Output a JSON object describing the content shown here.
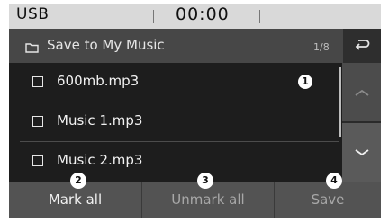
{
  "status_bar": {
    "source": "USB",
    "time": "00:00"
  },
  "header": {
    "folder_icon": "folder-icon",
    "title": "Save to My Music",
    "page_count": "1/8",
    "back_icon": "back-return-icon"
  },
  "files": [
    {
      "name": "600mb.mp3",
      "checked": false
    },
    {
      "name": "Music 1.mp3",
      "checked": false
    },
    {
      "name": "Music 2.mp3",
      "checked": false
    }
  ],
  "scroll": {
    "up_icon": "chevron-up-icon",
    "down_icon": "chevron-down-icon"
  },
  "buttons": {
    "mark_all": "Mark all",
    "unmark_all": "Unmark all",
    "save": "Save"
  },
  "callouts": [
    "1",
    "2",
    "3",
    "4"
  ]
}
